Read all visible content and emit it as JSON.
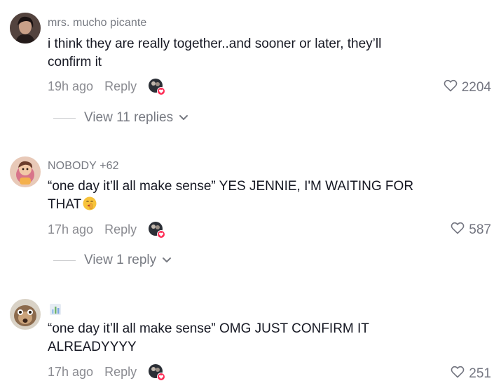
{
  "comments": [
    {
      "username": "mrs. mucho picante",
      "text": "i think they are really together..and sooner or later, they’ll confirm it",
      "time": "19h ago",
      "reply_label": "Reply",
      "likes": "2204",
      "view_replies": "View 11 replies"
    },
    {
      "username": "NOBODY +62",
      "text": "“one day it’ll all make sense” YES JENNIE, I'M WAITING FOR THAT",
      "time": "17h ago",
      "reply_label": "Reply",
      "likes": "587",
      "view_replies": "View 1 reply"
    },
    {
      "username": "",
      "text": "“one day it’ll all make sense” OMG JUST CONFIRM IT ALREADYYYY",
      "time": "17h ago",
      "reply_label": "Reply",
      "likes": "251"
    }
  ],
  "icons": {
    "like": "heart-outline-icon",
    "expand": "chevron-down-icon",
    "creator_liked": "creator-liked-avatar-icon",
    "emoji": "shushing-face-emoji",
    "username_icon": "bar-chart-icon"
  },
  "colors": {
    "primary_text": "#161823",
    "secondary_text": "#8a8b91",
    "liked_badge": "#fe2c55"
  }
}
